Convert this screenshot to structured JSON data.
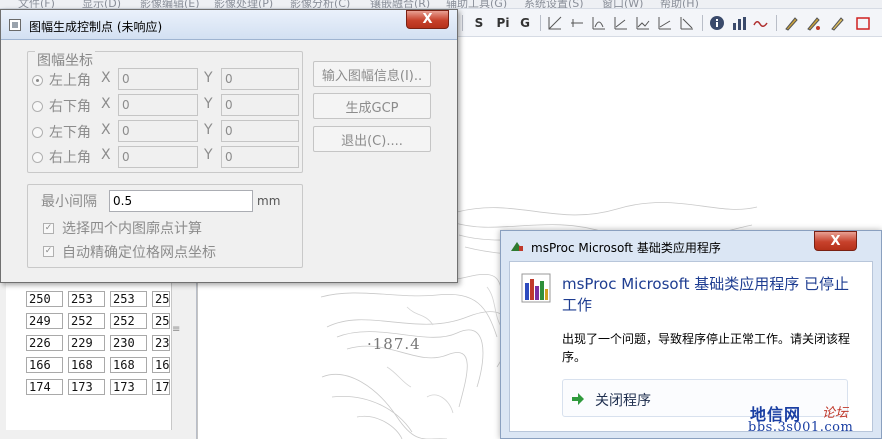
{
  "menubar": {
    "items": [
      "文件(F)",
      "显示(D)",
      "影像编辑(E)",
      "影像处理(P)",
      "影像分析(C)",
      "镶嵌融合(R)",
      "辅助工具(G)",
      "系统设置(S)",
      "窗口(W)",
      "帮助(H)"
    ]
  },
  "toolbar": {
    "text_buttons": [
      "S",
      "Pi",
      "G"
    ],
    "icons": [
      "grid-line-icon",
      "hline-icon",
      "curve-icon",
      "angle-icon",
      "chart-line-icon",
      "triangle-icon",
      "corner-icon",
      "info-icon",
      "bar-chart-icon",
      "wave-icon",
      "pen-icon",
      "pen-edit-icon",
      "pencil-icon",
      "rectangle-icon"
    ]
  },
  "gcp_dialog": {
    "title": "图幅生成控制点 (未响应)",
    "close_label": "X",
    "corner_group": {
      "legend": "图幅坐标",
      "rows": [
        {
          "label": "左上角",
          "x_label": "X",
          "x_value": "0",
          "y_label": "Y",
          "y_value": "0",
          "selected": true
        },
        {
          "label": "右下角",
          "x_label": "X",
          "x_value": "0",
          "y_label": "Y",
          "y_value": "0",
          "selected": false
        },
        {
          "label": "左下角",
          "x_label": "X",
          "x_value": "0",
          "y_label": "Y",
          "y_value": "0",
          "selected": false
        },
        {
          "label": "右上角",
          "x_label": "X",
          "x_value": "0",
          "y_label": "Y",
          "y_value": "0",
          "selected": false
        }
      ]
    },
    "buttons": {
      "input_info": "输入图幅信息(I)..",
      "generate_gcp": "生成GCP",
      "exit": "退出(C)...."
    },
    "interval": {
      "label": "最小间隔",
      "value": "0.5",
      "unit": "mm"
    },
    "options": [
      {
        "label": "选择四个内图廓点计算",
        "checked": true
      },
      {
        "label": "自动精确定位格网点坐标",
        "checked": true
      }
    ]
  },
  "value_grid": {
    "rows": [
      [
        "250",
        "253",
        "253",
        "25"
      ],
      [
        "249",
        "252",
        "252",
        "25"
      ],
      [
        "226",
        "229",
        "230",
        "23"
      ],
      [
        "166",
        "168",
        "168",
        "16"
      ],
      [
        "174",
        "173",
        "173",
        "17"
      ]
    ]
  },
  "map": {
    "elevation_label": "·187.4"
  },
  "error_dialog": {
    "title": "msProc Microsoft 基础类应用程序",
    "close_label": "X",
    "heading": "msProc Microsoft 基础类应用程序 已停止工作",
    "message": "出现了一个问题，导致程序停止正常工作。请关闭该程序。",
    "close_program_label": "关闭程序"
  },
  "watermark": {
    "main": "地信网",
    "suffix": "论坛",
    "url": "bbs.3s001.com"
  },
  "colors": {
    "close_button": "#c7412b",
    "error_heading": "#1e3d91",
    "dialog_bg": "#f0f0f0",
    "disabled_text": "#8c8c8c"
  }
}
